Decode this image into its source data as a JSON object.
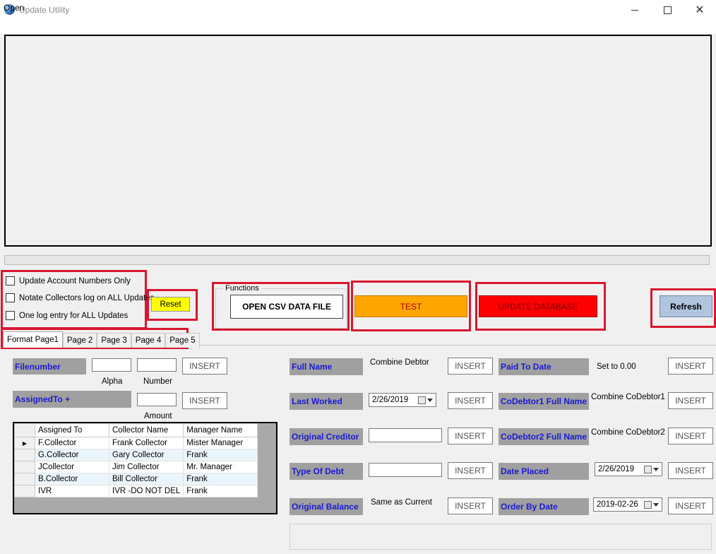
{
  "window": {
    "title": "Update Utility",
    "close_glyph": "✕"
  },
  "menu": {
    "open": "Open"
  },
  "options": [
    {
      "label": "Update Account Numbers Only"
    },
    {
      "label": "Notate Collectors log on ALL Updates"
    },
    {
      "label": "One log entry for ALL Updates"
    }
  ],
  "buttons": {
    "reset": "Reset",
    "functions_group": "Functions",
    "open_csv": "OPEN CSV DATA FILE",
    "test": "TEST",
    "update_db": "UPDATE DATABASE",
    "refresh": "Refresh"
  },
  "tabs": [
    "Format Page1",
    "Page 2",
    "Page 3",
    "Page 4",
    "Page 5"
  ],
  "form": {
    "filenumber": "Filenumber",
    "alpha": "Alpha",
    "number": "Number",
    "assigned_to": "AssignedTo +",
    "amount": "Amount",
    "insert": "INSERT",
    "full_name": "Full Name",
    "full_name_value": "Combine Debtor",
    "last_worked": "Last Worked",
    "last_worked_date": "2/26/2019",
    "original_creditor": "Original Creditor",
    "type_of_debt": "Type Of Debt",
    "original_balance": "Original Balance",
    "original_balance_value": "Same as Current",
    "paid_to_date": "Paid To Date",
    "paid_to_date_value": "Set to 0.00",
    "codebtor1": "CoDebtor1 Full Name",
    "codebtor1_value": "Combine CoDebtor1",
    "codebtor2": "CoDebtor2 Full Name",
    "codebtor2_value": "Combine CoDebtor2",
    "date_placed": "Date Placed",
    "date_placed_value": "2/26/2019",
    "order_by_date": "Order By Date",
    "order_by_date_value": "2019-02-26"
  },
  "grid": {
    "columns": [
      "Assigned To",
      "Collector Name",
      "Manager Name"
    ],
    "row_indicator": "▶",
    "rows": [
      [
        "F.Collector",
        "Frank Collector",
        "Mister Manager"
      ],
      [
        "G.Collector",
        "Gary Collector",
        "Frank"
      ],
      [
        "JCollector",
        "Jim Collector",
        "Mr. Manager"
      ],
      [
        "B.Collector",
        "Bill Collector",
        "Frank"
      ],
      [
        "IVR",
        "IVR -DO NOT DEL",
        "Frank"
      ]
    ]
  },
  "colors": {
    "highlight_border": "#d7172f",
    "reset_bg": "#ffff00",
    "test_bg": "#ffa500",
    "update_bg": "#ff0000",
    "refresh_bg": "#b0c4de",
    "label_bg": "#a0a0a0",
    "label_text": "#1a1ad4"
  },
  "icons": {
    "app": "globe-icon",
    "minimize": "minimize-icon",
    "maximize": "maximize-icon",
    "close": "close-icon",
    "calendar": "calendar-icon",
    "dropdown": "chevron-down-icon",
    "row_pointer": "row-pointer-icon"
  }
}
